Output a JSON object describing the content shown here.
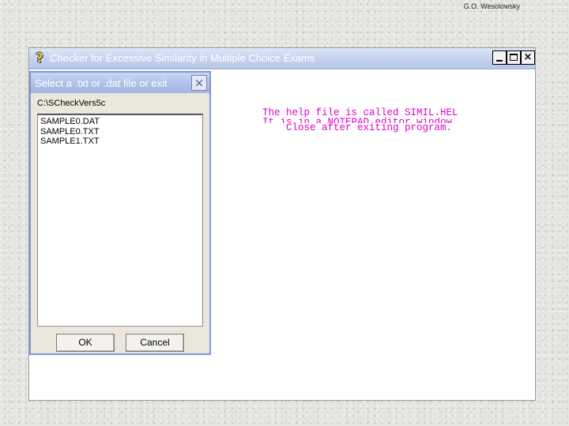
{
  "author": "G.O. Wesolowsky",
  "main_window": {
    "title": "Checker for Excessive Similarity in Multiple Choice Exams",
    "icon": "question-mark-icon",
    "controls": {
      "minimize": "minimize-icon",
      "maximize": "maximize-icon",
      "close": "×"
    }
  },
  "help_text": {
    "line1": "The help file is called SIMIL.HEL",
    "line2": "It is in a NOTEPAD editor window.",
    "line3": "    Close after exiting program."
  },
  "dialog": {
    "title": "Select a .txt or .dat file or exit",
    "close": "×",
    "directory": "C:\\SCheckVers5c",
    "files": [
      "SAMPLE0.DAT",
      "SAMPLE0.TXT",
      "SAMPLE1.TXT"
    ],
    "ok_label": "OK",
    "cancel_label": "Cancel"
  },
  "colors": {
    "titlebar": "#c7d4ef",
    "help_text": "#e000c8",
    "dialog_bg": "#ece7dc",
    "dialog_border": "#7e98d6"
  }
}
